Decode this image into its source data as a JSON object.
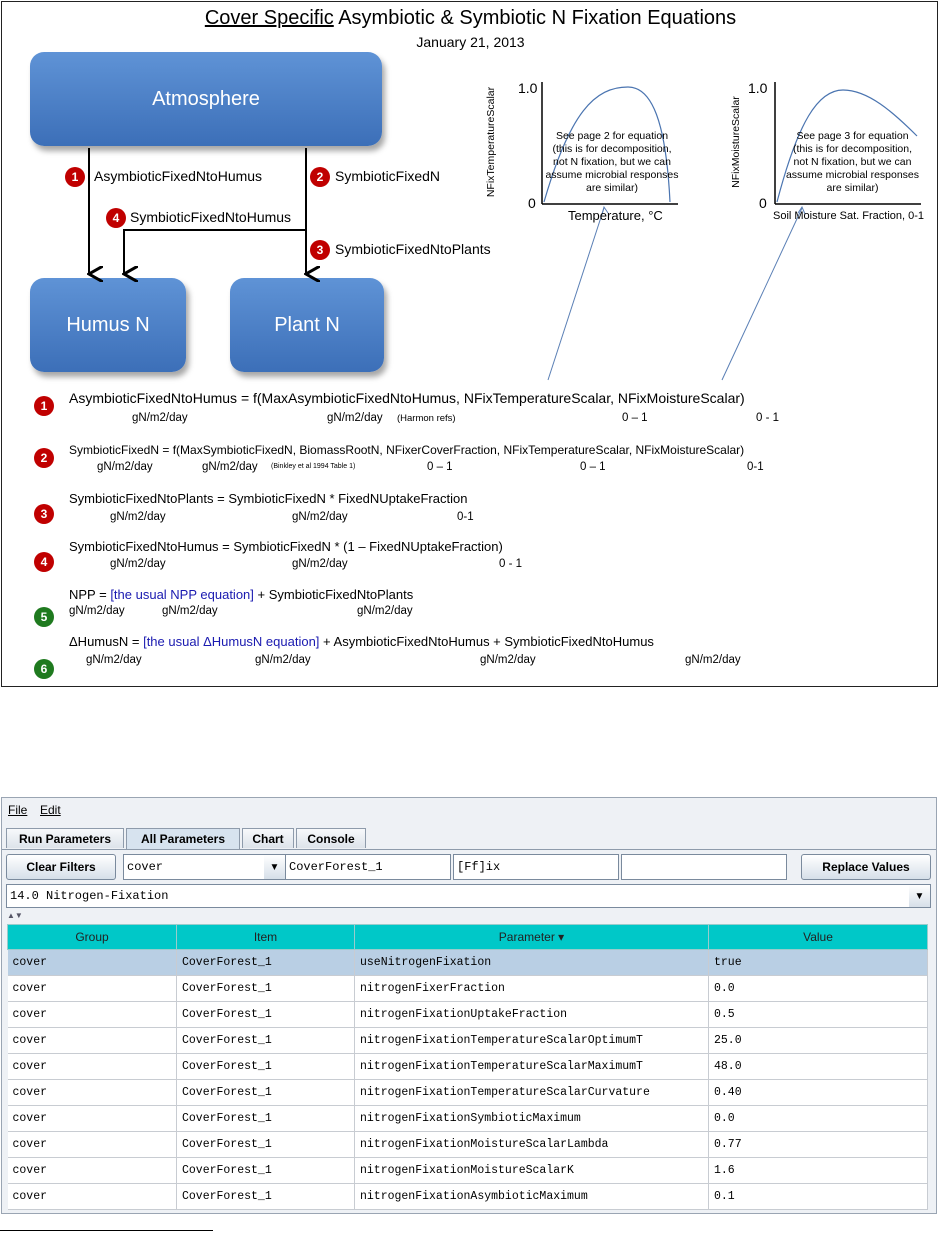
{
  "diagram": {
    "title_underlined": "Cover Specific",
    "title_rest": " Asymbiotic & Symbiotic N Fixation Equations",
    "date": "January 21, 2013",
    "boxes": {
      "atmosphere": "Atmosphere",
      "humus": "Humus N",
      "plant": "Plant N"
    },
    "flows": [
      {
        "num": "1",
        "label": "AsymbioticFixedNtoHumus"
      },
      {
        "num": "2",
        "label": "SymbioticFixedN"
      },
      {
        "num": "3",
        "label": "SymbioticFixedNtoPlants"
      },
      {
        "num": "4",
        "label": "SymbioticFixedNtoHumus"
      }
    ],
    "plots": [
      {
        "ylabel": "NFixTemperatureScalar",
        "xlabel": "Temperature, °C",
        "ymax": "1.0",
        "ymin": "0",
        "note": [
          "See page 2 for equation",
          "(this is for decomposition,",
          "not N fixation, but we can",
          "assume microbial responses",
          "are similar)"
        ]
      },
      {
        "ylabel": "NFixMoistureScalar",
        "xlabel": "Soil Moisture Sat. Fraction, 0-1",
        "ymax": "1.0",
        "ymin": "0",
        "note": [
          "See page 3 for equation",
          "(this is for decomposition,",
          "not N fixation, but we can",
          "assume microbial responses",
          "are similar)"
        ]
      }
    ],
    "equations": [
      {
        "num": "1",
        "text": "AsymbioticFixedNtoHumus = f(MaxAsymbioticFixedNtoHumus, NFixTemperatureScalar, NFixMoistureScalar)",
        "units": [
          "gN/m2/day",
          "gN/m2/day",
          "(Harmon refs)",
          "0 – 1",
          "0 - 1"
        ]
      },
      {
        "num": "2",
        "text": "SymbioticFixedN = f(MaxSymbioticFixedN, BiomassRootN, NFixerCoverFraction, NFixTemperatureScalar, NFixMoistureScalar)",
        "units": [
          "gN/m2/day",
          "gN/m2/day",
          "(Binkley et al 1994 Table 1)",
          "0 – 1",
          "0 – 1",
          "0-1"
        ]
      },
      {
        "num": "3",
        "text": "SymbioticFixedNtoPlants = SymbioticFixedN  * FixedNUptakeFraction",
        "units": [
          "gN/m2/day",
          "gN/m2/day",
          "0-1"
        ]
      },
      {
        "num": "4",
        "text": "SymbioticFixedNtoHumus = SymbioticFixedN * (1 – FixedNUptakeFraction)",
        "units": [
          "gN/m2/day",
          "gN/m2/day",
          "0 - 1"
        ]
      },
      {
        "num": "5",
        "pre": "NPP = ",
        "blue": "[the usual NPP equation]",
        "post": " + SymbioticFixedNtoPlants",
        "units": [
          "gN/m2/day",
          "gN/m2/day",
          "gN/m2/day"
        ]
      },
      {
        "num": "6",
        "pre": "ΔHumusN =  ",
        "blue": "[the usual ΔHumusN equation]",
        "post": " + AsymbioticFixedNtoHumus  + SymbioticFixedNtoHumus",
        "units": [
          "gN/m2/day",
          "gN/m2/day",
          "gN/m2/day",
          "gN/m2/day"
        ]
      }
    ]
  },
  "app": {
    "menu": [
      "File",
      "Edit"
    ],
    "tabs": [
      "Run Parameters",
      "All Parameters",
      "Chart",
      "Console"
    ],
    "active_tab": "All Parameters",
    "clear_filters": "Clear Filters",
    "group_filter": "cover",
    "item_filter": "CoverForest_1",
    "param_filter": "[Ff]ix",
    "value_filter": "",
    "replace_values": "Replace Values",
    "section": "14.0    Nitrogen-Fixation",
    "columns": [
      "Group",
      "Item",
      "Parameter ▾",
      "Value"
    ],
    "rows": [
      [
        "cover",
        "CoverForest_1",
        "useNitrogenFixation",
        "true"
      ],
      [
        "cover",
        "CoverForest_1",
        "nitrogenFixerFraction",
        "0.0"
      ],
      [
        "cover",
        "CoverForest_1",
        "nitrogenFixationUptakeFraction",
        "0.5"
      ],
      [
        "cover",
        "CoverForest_1",
        "nitrogenFixationTemperatureScalarOptimumT",
        "25.0"
      ],
      [
        "cover",
        "CoverForest_1",
        "nitrogenFixationTemperatureScalarMaximumT",
        "48.0"
      ],
      [
        "cover",
        "CoverForest_1",
        "nitrogenFixationTemperatureScalarCurvature",
        "0.40"
      ],
      [
        "cover",
        "CoverForest_1",
        "nitrogenFixationSymbioticMaximum",
        "0.0"
      ],
      [
        "cover",
        "CoverForest_1",
        "nitrogenFixationMoistureScalarLambda",
        "0.77"
      ],
      [
        "cover",
        "CoverForest_1",
        "nitrogenFixationMoistureScalarK",
        "1.6"
      ],
      [
        "cover",
        "CoverForest_1",
        "nitrogenFixationAsymbioticMaximum",
        "0.1"
      ]
    ]
  }
}
